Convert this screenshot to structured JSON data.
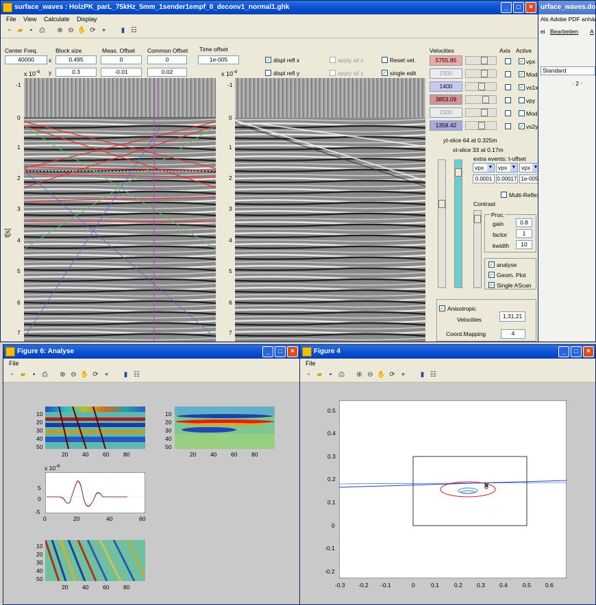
{
  "main_window": {
    "title": "surface_waves : HolzPK_parL_75kHz_5mm_1sender1empf_0_deconv1_normal1.ghk",
    "menu": [
      "File",
      "View",
      "Calculate",
      "Display"
    ],
    "params": {
      "center_freq": {
        "label": "Center Freq.",
        "value": "40000"
      },
      "block_size": {
        "label": "Block size",
        "x_label": "x",
        "y_label": "y",
        "x": "0.495",
        "y": "0.3"
      },
      "meas_offset": {
        "label": "Meas. Offset",
        "x": "0",
        "y": "-0.01"
      },
      "common_offset": {
        "label": "Common Offset",
        "x": "0",
        "y": "0.02"
      },
      "time_offset": {
        "label": "Time offset",
        "value": "1e-005"
      }
    },
    "checks": {
      "displ_refl_x": "displ refl x",
      "displ_refl_y": "displ refl y",
      "apply_all_x": "apply all x",
      "apply_all_y": "apply all y",
      "reset_vel": "Reset vel.",
      "single_edit": "single edit"
    },
    "plot": {
      "exp_label": "x 10",
      "exp_power": "-4",
      "ylabel": "t[s]",
      "yticks": [
        "-1",
        "0",
        "1",
        "2",
        "3",
        "4",
        "5",
        "6",
        "7"
      ]
    },
    "velocities": {
      "header": "Velocities",
      "axis_header": "Axis",
      "active_header": "Active",
      "rows": [
        {
          "value": "5755.85",
          "color": "#f0a8a8",
          "name": "vpx"
        },
        {
          "value": "2300",
          "color": "#ececec",
          "name": "ModC"
        },
        {
          "value": "1400",
          "color": "#c8c8f0",
          "name": "vs1x"
        },
        {
          "value": "3853.09",
          "color": "#d89494",
          "name": "vpy"
        },
        {
          "value": "2300",
          "color": "#ececec",
          "name": "ModC"
        },
        {
          "value": "1358.42",
          "color": "#a9a9dc",
          "name": "vs2y"
        }
      ]
    },
    "slices": {
      "yt": "yt-slice 64 at 0.325m",
      "xt": "xt-slice 33 at 0.17m"
    },
    "extra_events": {
      "label": "extra events: t-offset",
      "selects": [
        "vpx",
        "vpx",
        "vpx"
      ],
      "values": [
        "0.0001",
        "0.00017",
        "1e-005"
      ]
    },
    "multi_reflex": "Multi-Reflex",
    "contrast": "Contrast",
    "proc": {
      "title": "Proc.",
      "gain_label": "gain",
      "gain": "0.8",
      "factor_label": "factor",
      "factor": "1",
      "kwidth_label": "kwidth",
      "kwidth": "10"
    },
    "options": {
      "analyse": "analyse",
      "geom_plot": "Geom. Plot",
      "single_ascan": "Single AScan"
    },
    "anisotropic": {
      "label": "Anisotropic",
      "velocities_label": "Velocities",
      "velocities": "1,31,21",
      "coord_label": "Coord.Mapping",
      "coord": "4"
    }
  },
  "bg_window": {
    "title": "urface_waves.do",
    "pdf": "Als Adobe PDF anhäng",
    "menu_bearbeiten": "Bearbeiten",
    "menu_a": "A",
    "menu_ei": "ei",
    "style": "Standard",
    "ruler": "· 2 ·"
  },
  "fig6": {
    "title": "Figure 6: Analyse",
    "menu": [
      "File"
    ],
    "plot1": {
      "yticks": [
        "10",
        "20",
        "30",
        "40",
        "50"
      ],
      "xticks": [
        "20",
        "40",
        "60",
        "80"
      ]
    },
    "plot2": {
      "yticks": [
        "10",
        "20",
        "30",
        "40",
        "50"
      ],
      "xticks": [
        "20",
        "40",
        "60",
        "80"
      ]
    },
    "plot3": {
      "exp": "x 10",
      "exp_power": "-4",
      "yticks": [
        "5",
        "0",
        "-5"
      ],
      "xticks": [
        "0",
        "20",
        "40",
        "60"
      ]
    },
    "plot4": {
      "yticks": [
        "10",
        "20",
        "30",
        "40",
        "50"
      ],
      "xticks": [
        "20",
        "40",
        "60",
        "80"
      ]
    }
  },
  "fig4": {
    "title": "Figure 4",
    "menu": [
      "File"
    ],
    "yticks": [
      "0.5",
      "0.4",
      "0.3",
      "0.2",
      "0.1",
      "0",
      "-0.1",
      "-0.2"
    ],
    "xticks": [
      "-0.3",
      "-0.2",
      "-0.1",
      "0",
      "0.1",
      "0.2",
      "0.3",
      "0.4",
      "0.5",
      "0.6"
    ]
  }
}
